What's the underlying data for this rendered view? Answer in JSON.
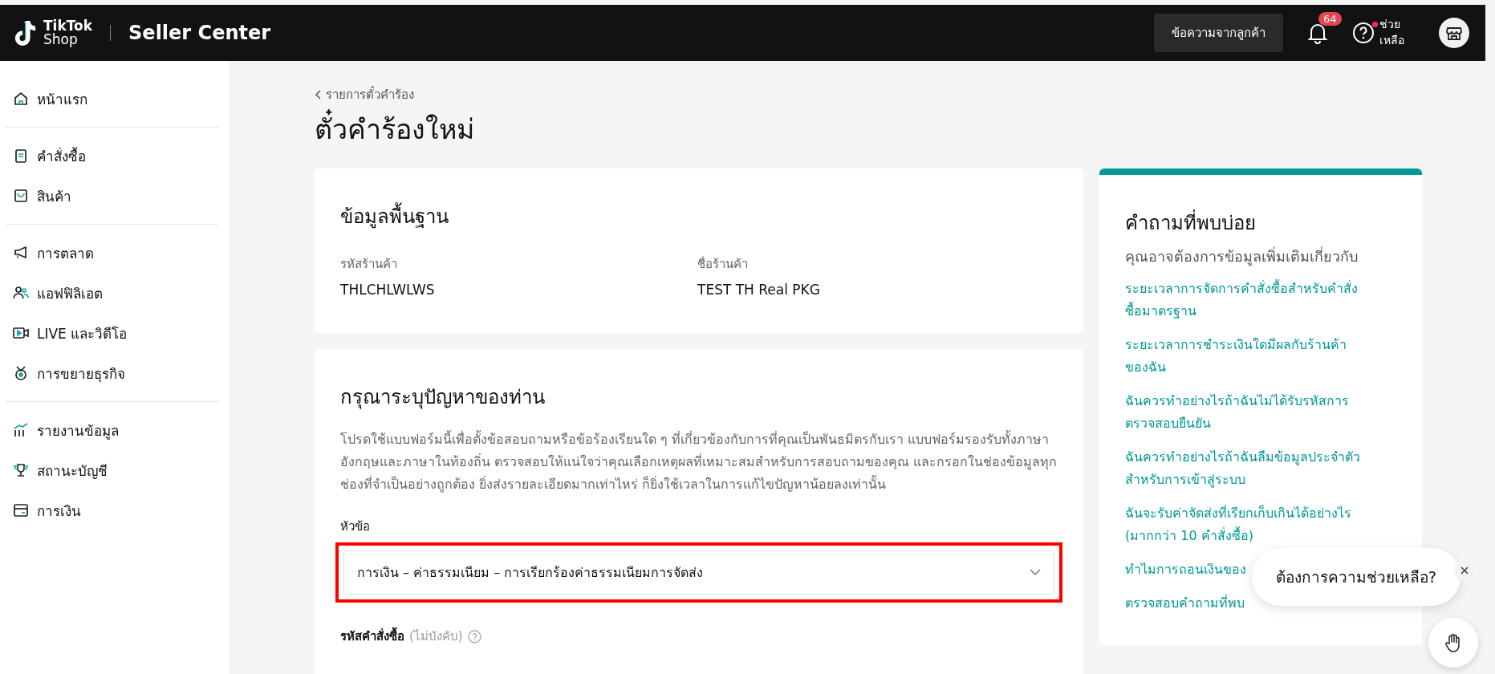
{
  "header": {
    "logo_line1": "TikTok",
    "logo_line2": "Shop",
    "product": "Seller Center",
    "messages_button": "ข้อความจากลูกค้า",
    "notifications_badge": "64",
    "help_dot": true,
    "help_label": "ช่วยเหลือ"
  },
  "sidebar": {
    "groups": [
      {
        "items": [
          {
            "label": "หน้าแรก",
            "kind": "home"
          }
        ]
      },
      {
        "items": [
          {
            "label": "คำสั่งซื้อ",
            "kind": "clipboard"
          },
          {
            "label": "สินค้า",
            "kind": "bag"
          }
        ]
      },
      {
        "items": [
          {
            "label": "การตลาด",
            "kind": "megaphone"
          },
          {
            "label": "แอฟฟิลิเอต",
            "kind": "people"
          },
          {
            "label": "LIVE และวิดีโอ",
            "kind": "video"
          },
          {
            "label": "การขยายธุรกิจ",
            "kind": "medal"
          }
        ]
      },
      {
        "items": [
          {
            "label": "รายงานข้อมูล",
            "kind": "chart"
          },
          {
            "label": "สถานะบัญชี",
            "kind": "trophy"
          },
          {
            "label": "การเงิน",
            "kind": "wallet"
          }
        ]
      }
    ]
  },
  "breadcrumb": "รายการตั๋วคำร้อง",
  "page_title": "ตั๋วคำร้องใหม่",
  "basic_info": {
    "title": "ข้อมูลพื้นฐาน",
    "fields": [
      {
        "label": "รหัสร้านค้า",
        "value": "THLCHLWLWS"
      },
      {
        "label": "ชื่อร้านค้า",
        "value": "TEST TH Real PKG"
      }
    ]
  },
  "issue": {
    "title": "กรุณาระบุปัญหาของท่าน",
    "description": "โปรดใช้แบบฟอร์มนี้เพื่อตั้งข้อสอบถามหรือข้อร้องเรียนใด ๆ ที่เกี่ยวข้องกับการที่คุณเป็นพันธมิตรกับเรา แบบฟอร์มรองรับทั้งภาษาอังกฤษและภาษาในท้องถิ่น ตรวจสอบให้แน่ใจว่าคุณเลือกเหตุผลที่เหมาะสมสำหรับการสอบถามของคุณ และกรอกในช่องข้อมูลทุกช่องที่จำเป็นอย่างถูกต้อง ยิ่งส่งรายละเอียดมากเท่าไหร่ ก็ยิ่งใช้เวลาในการแก้ไขปัญหาน้อยลงเท่านั้น",
    "topic_label": "หัวข้อ",
    "topic_value": "การเงิน – ค่าธรรมเนียม – การเรียกร้องค่าธรรมเนียมการจัดส่ง",
    "topic_highlighted": true,
    "order_label": "รหัสคำสั่งซื้อ",
    "order_optional": "(ไม่บังคับ)"
  },
  "faq": {
    "title": "คำถามที่พบบ่อย",
    "subtitle": "คุณอาจต้องการข้อมูลเพิ่มเติมเกี่ยวกับ",
    "links": [
      "ระยะเวลาการจัดการคำสั่งซื้อสำหรับคำสั่งซื้อมาตรฐาน",
      "ระยะเวลาการชำระเงินใดมีผลกับร้านค้าของฉัน",
      "ฉันควรทำอย่างไรถ้าฉันไม่ได้รับรหัสการตรวจสอบยืนยัน",
      "ฉันควรทำอย่างไรถ้าฉันลืมข้อมูลประจำตัวสำหรับการเข้าสู่ระบบ",
      "ฉันจะรับค่าจัดส่งที่เรียกเก็บเกินได้อย่างไร (มากกว่า 10 คำสั่งซื้อ)",
      "ทำไมการถอนเงินของ",
      "ตรวจสอบคำถามที่พบ"
    ]
  },
  "chat_prompt": {
    "text": "ต้องการความช่วยเหลือ?"
  }
}
